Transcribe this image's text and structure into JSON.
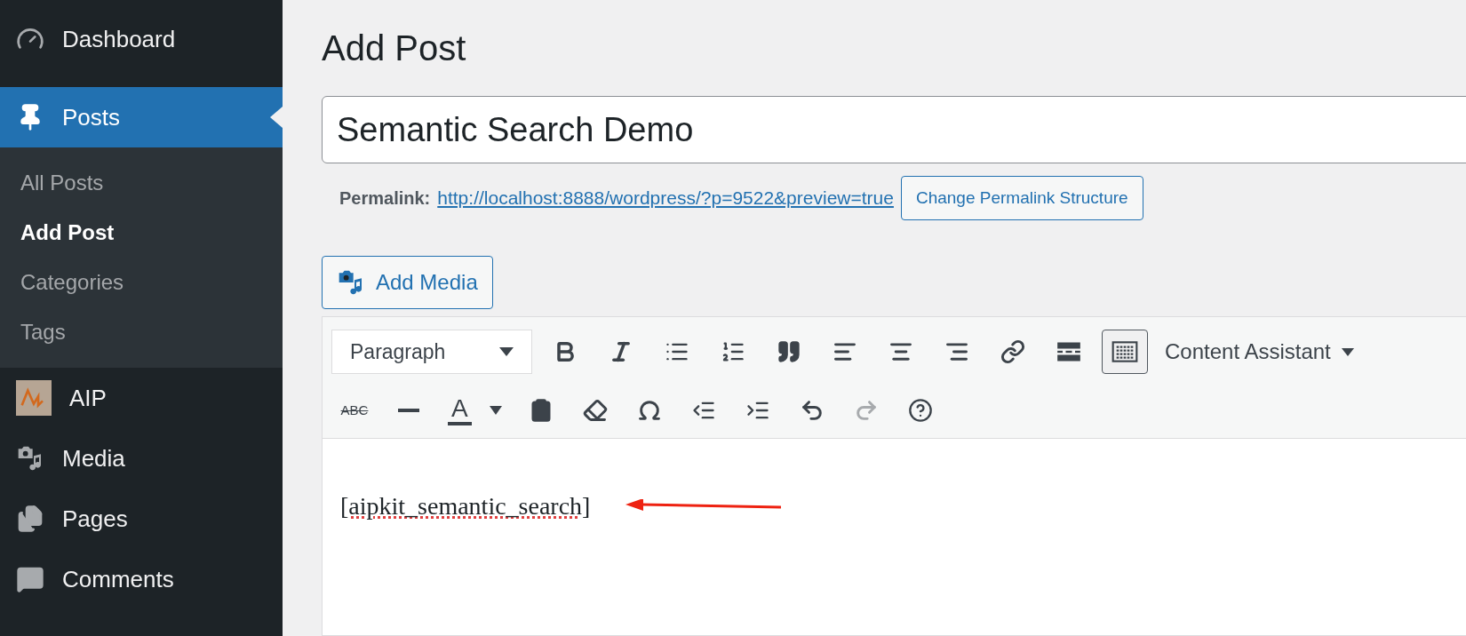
{
  "sidebar": {
    "items": [
      {
        "label": "Dashboard",
        "selected": false
      },
      {
        "label": "Posts",
        "selected": true,
        "children": [
          {
            "label": "All Posts",
            "selected": false
          },
          {
            "label": "Add Post",
            "selected": true
          },
          {
            "label": "Categories",
            "selected": false
          },
          {
            "label": "Tags",
            "selected": false
          }
        ]
      },
      {
        "label": "AIP",
        "selected": false
      },
      {
        "label": "Media",
        "selected": false
      },
      {
        "label": "Pages",
        "selected": false
      },
      {
        "label": "Comments",
        "selected": false
      }
    ]
  },
  "page_title": "Add Post",
  "post_title": {
    "value": "Semantic Search Demo"
  },
  "permalink": {
    "label": "Permalink:",
    "url": "http://localhost:8888/wordpress/?p=9522&preview=true",
    "button": "Change Permalink Structure"
  },
  "add_media": "Add Media",
  "toolbar": {
    "format_select": "Paragraph",
    "content_assistant": "Content Assistant",
    "row_1": [
      {
        "pressed": false,
        "disabled": false
      },
      {
        "pressed": false,
        "disabled": false
      },
      {
        "pressed": false,
        "disabled": false
      },
      {
        "pressed": false,
        "disabled": false
      },
      {
        "pressed": false,
        "disabled": false
      },
      {
        "pressed": false,
        "disabled": false
      },
      {
        "pressed": false,
        "disabled": false
      },
      {
        "pressed": false,
        "disabled": false
      },
      {
        "pressed": false,
        "disabled": false
      },
      {
        "pressed": false,
        "disabled": false
      },
      {
        "pressed": true,
        "disabled": false
      }
    ],
    "row_2": [
      {
        "kind": "text",
        "label": "ABC",
        "pressed": false,
        "disabled": false
      },
      {
        "kind": "icon",
        "pressed": false,
        "disabled": false
      },
      {
        "kind": "color",
        "label": "A",
        "pressed": false,
        "disabled": false
      },
      {
        "kind": "icon",
        "pressed": false,
        "disabled": false
      },
      {
        "kind": "icon",
        "pressed": false,
        "disabled": false
      },
      {
        "kind": "icon",
        "pressed": false,
        "disabled": false
      },
      {
        "kind": "icon",
        "pressed": false,
        "disabled": false
      },
      {
        "kind": "icon",
        "pressed": false,
        "disabled": false
      },
      {
        "kind": "icon",
        "pressed": false,
        "disabled": false
      },
      {
        "kind": "icon",
        "pressed": false,
        "disabled": true
      },
      {
        "kind": "icon",
        "pressed": false,
        "disabled": false
      }
    ]
  },
  "content": "[aipkit_semantic_search]"
}
